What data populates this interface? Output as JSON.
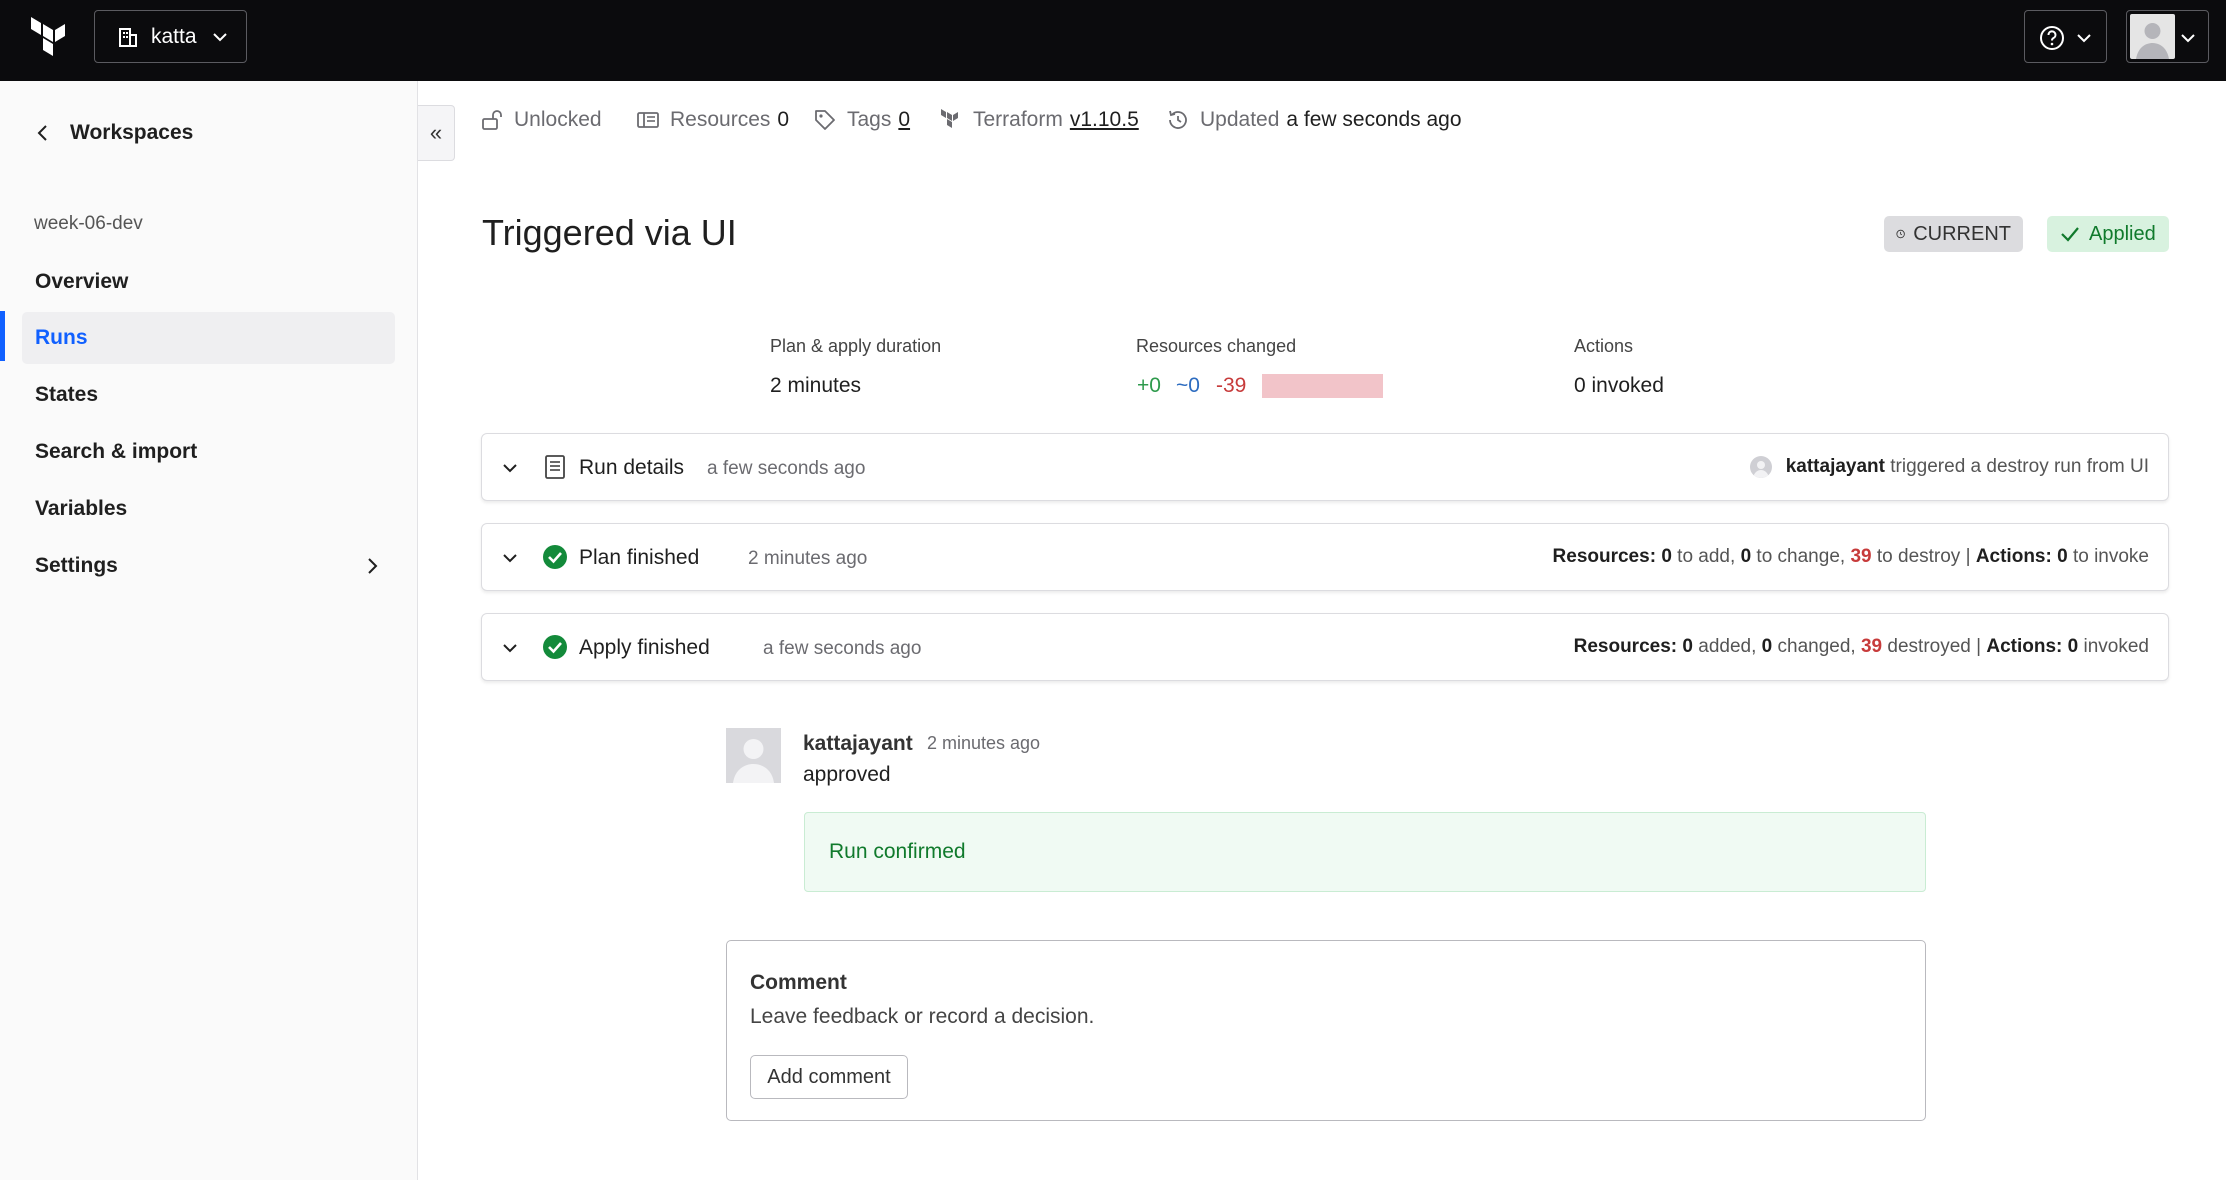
{
  "topbar": {
    "org_name": "katta"
  },
  "sidebar": {
    "back_label": "Workspaces",
    "workspace_name": "week-06-dev",
    "items": [
      {
        "label": "Overview"
      },
      {
        "label": "Runs"
      },
      {
        "label": "States"
      },
      {
        "label": "Search & import"
      },
      {
        "label": "Variables"
      },
      {
        "label": "Settings"
      }
    ],
    "active_item": "Runs",
    "collapse_glyph": "«"
  },
  "meta": {
    "lock_label": "Unlocked",
    "resources_label": "Resources",
    "resources_count": "0",
    "tags_label": "Tags",
    "tags_count": "0",
    "terraform_label": "Terraform",
    "terraform_version": "v1.10.5",
    "updated_label": "Updated",
    "updated_value": "a few seconds ago"
  },
  "run": {
    "title": "Triggered via UI",
    "badge_current": "CURRENT",
    "badge_applied": "Applied"
  },
  "stats": {
    "duration_label": "Plan & apply duration",
    "duration_value": "2 minutes",
    "resources_label": "Resources changed",
    "add": "+0",
    "change": "~0",
    "destroy": "-39",
    "actions_label": "Actions",
    "actions_value": "0 invoked"
  },
  "panels": {
    "details": {
      "title": "Run details",
      "time": "a few seconds ago",
      "user": "kattajayant",
      "summary": "triggered a destroy run from UI"
    },
    "plan": {
      "title": "Plan finished",
      "time": "2 minutes ago",
      "resources_label": "Resources:",
      "add": "0",
      "add_label": "to add,",
      "change": "0",
      "change_label": "to change,",
      "destroy": "39",
      "destroy_label": "to destroy",
      "separator": "|",
      "actions_label": "Actions:",
      "actions": "0",
      "actions_suffix": "to invoke"
    },
    "apply": {
      "title": "Apply finished",
      "time": "a few seconds ago",
      "resources_label": "Resources:",
      "add": "0",
      "add_label": "added,",
      "change": "0",
      "change_label": "changed,",
      "destroy": "39",
      "destroy_label": "destroyed",
      "separator": "|",
      "actions_label": "Actions:",
      "actions": "0",
      "actions_suffix": "invoked"
    }
  },
  "comment": {
    "user": "kattajayant",
    "time": "2 minutes ago",
    "text": "approved",
    "confirmed": "Run confirmed"
  },
  "comment_box": {
    "title": "Comment",
    "description": "Leave feedback or record a decision.",
    "button": "Add comment"
  },
  "colors": {
    "topbar": "#0b0b0d",
    "accent": "#1060ff",
    "success": "#107a2c",
    "add": "#2e9a4c",
    "change": "#2d6cc0",
    "destroy": "#c73b3b"
  }
}
